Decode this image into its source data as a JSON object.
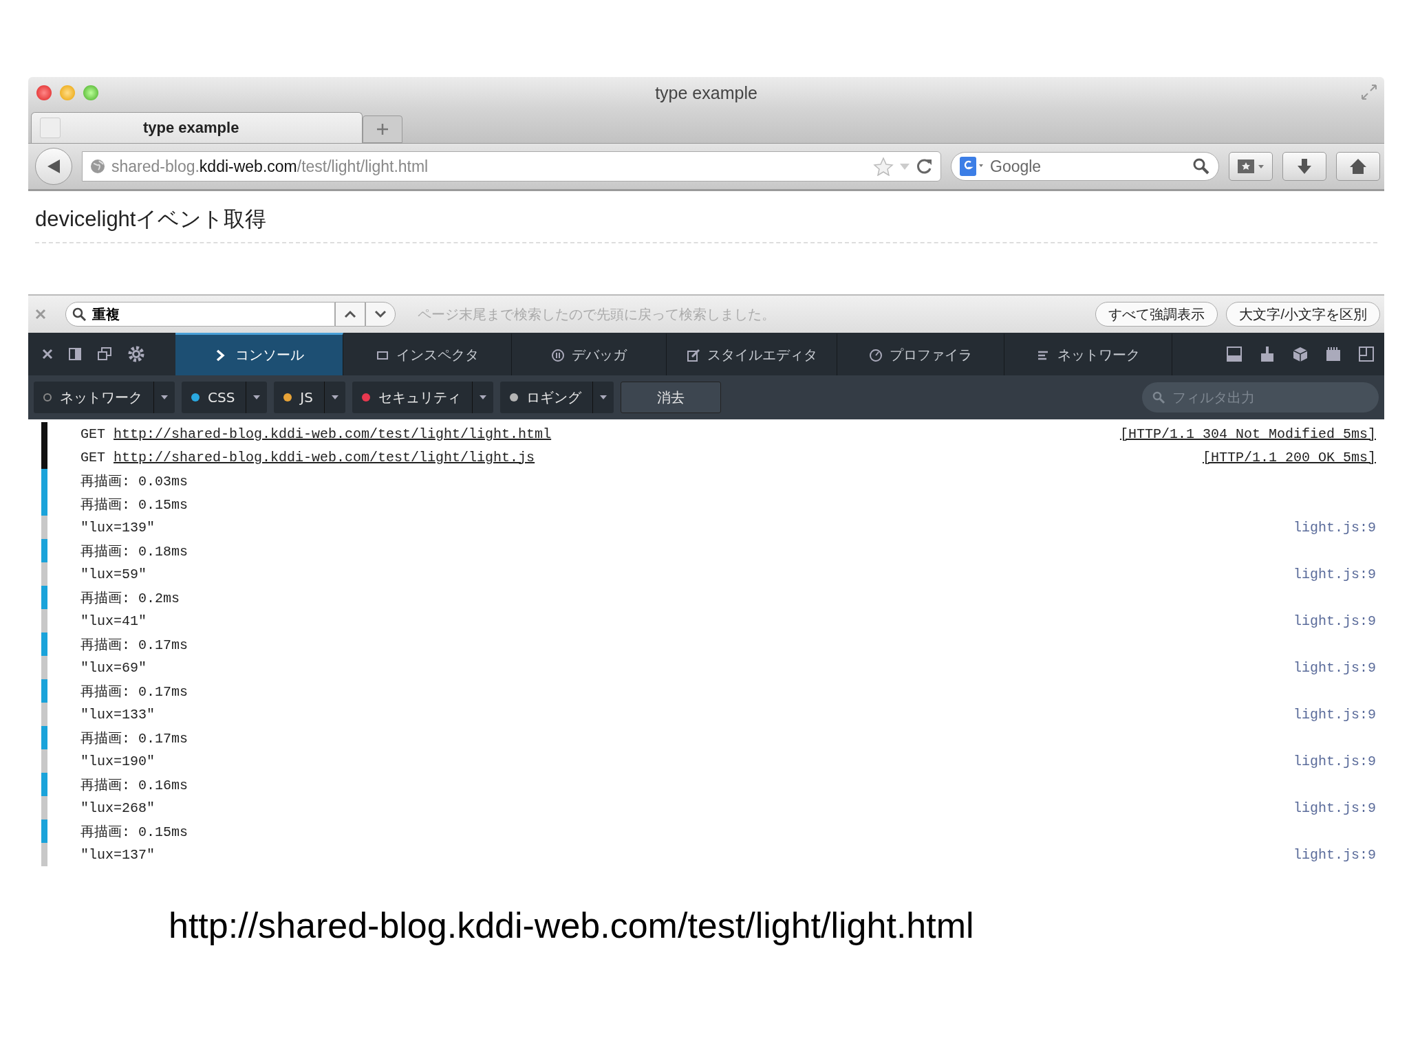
{
  "window": {
    "title": "type example"
  },
  "tabs": [
    {
      "label": "type example",
      "selected": true
    }
  ],
  "address_bar": {
    "url": "shared-blog.**kddi-web.com**/test/light/light.html"
  },
  "search_bar": {
    "placeholder": "Google"
  },
  "page": {
    "heading": "devicelightイベント取得"
  },
  "find_bar": {
    "value": "重複",
    "message": "ページ末尾まで検索したので先頭に戻って検索しました。",
    "buttons": [
      "すべて強調表示",
      "大文字/小文字を区別"
    ]
  },
  "devtools": {
    "tabs": [
      {
        "label": "コンソール",
        "kind": "console",
        "selected": true
      },
      {
        "label": "インスペクタ",
        "kind": "inspector",
        "selected": false
      },
      {
        "label": "デバッガ",
        "kind": "debugger",
        "selected": false
      },
      {
        "label": "スタイルエディタ",
        "kind": "style",
        "selected": false
      },
      {
        "label": "プロファイラ",
        "kind": "profiler",
        "selected": false
      },
      {
        "label": "ネットワーク",
        "kind": "network",
        "selected": false
      }
    ],
    "filters": [
      {
        "label": "ネットワーク",
        "color": "#3a3f47"
      },
      {
        "label": "CSS",
        "color": "#2aa8e0"
      },
      {
        "label": "JS",
        "color": "#e8a337"
      },
      {
        "label": "セキュリティ",
        "color": "#e8384f"
      },
      {
        "label": "ロギング",
        "color": "#b4b4b4"
      }
    ],
    "clear_button": "消去",
    "filter_placeholder": "フィルタ出力"
  },
  "console": [
    {
      "kind": "network",
      "method": "GET",
      "url": "http://shared-blog.kddi-web.com/test/light/light.html",
      "status": "[HTTP/1.1 304 Not Modified 5ms]"
    },
    {
      "kind": "network",
      "method": "GET",
      "url": "http://shared-blog.kddi-web.com/test/light/light.js",
      "status": "[HTTP/1.1 200 OK 5ms]"
    },
    {
      "kind": "css",
      "text": "再描画: 0.03ms"
    },
    {
      "kind": "css",
      "text": "再描画: 0.15ms"
    },
    {
      "kind": "log",
      "text": "\"lux=139\"",
      "source": "light.js:9"
    },
    {
      "kind": "css",
      "text": "再描画: 0.18ms"
    },
    {
      "kind": "log",
      "text": "\"lux=59\"",
      "source": "light.js:9"
    },
    {
      "kind": "css",
      "text": "再描画: 0.2ms"
    },
    {
      "kind": "log",
      "text": "\"lux=41\"",
      "source": "light.js:9"
    },
    {
      "kind": "css",
      "text": "再描画: 0.17ms"
    },
    {
      "kind": "log",
      "text": "\"lux=69\"",
      "source": "light.js:9"
    },
    {
      "kind": "css",
      "text": "再描画: 0.17ms"
    },
    {
      "kind": "log",
      "text": "\"lux=133\"",
      "source": "light.js:9"
    },
    {
      "kind": "css",
      "text": "再描画: 0.17ms"
    },
    {
      "kind": "log",
      "text": "\"lux=190\"",
      "source": "light.js:9"
    },
    {
      "kind": "css",
      "text": "再描画: 0.16ms"
    },
    {
      "kind": "log",
      "text": "\"lux=268\"",
      "source": "light.js:9"
    },
    {
      "kind": "css",
      "text": "再描画: 0.15ms"
    },
    {
      "kind": "log",
      "text": "\"lux=137\"",
      "source": "light.js:9"
    }
  ],
  "caption": "http://shared-blog.kddi-web.com/test/light/light.html"
}
